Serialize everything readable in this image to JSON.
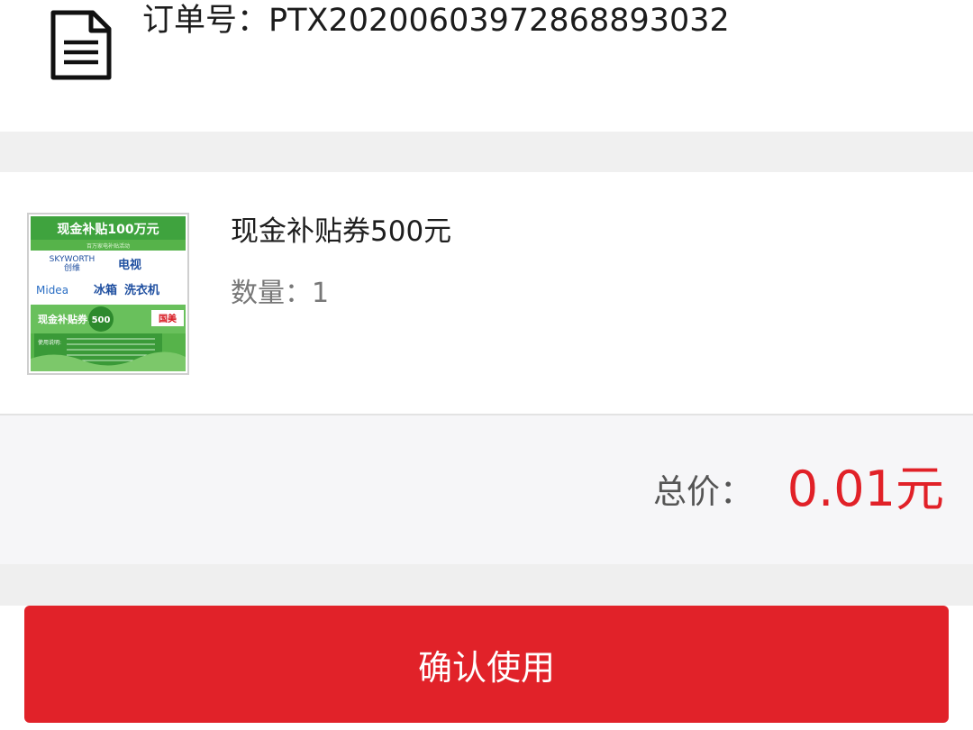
{
  "order": {
    "icon": "document-icon",
    "number_label": "订单号：PTX20200603972868893032"
  },
  "item": {
    "name": "现金补贴券500元",
    "quantity_label": "数量：1",
    "thumbnail": {
      "banner": "现金补贴100万元",
      "subline": "百万家电补贴活动",
      "brand1": "SKYWORTH",
      "brand1_cn": "创维",
      "product1": "电视",
      "brand2": "Midea",
      "product2": "冰箱",
      "product3": "洗衣机",
      "coupon_text": "现金补贴券:",
      "coupon_value": "500",
      "coupon_unit": "元",
      "store_logo": "国美",
      "usage_label": "使用说明:",
      "colors": {
        "green": "#3aa83a",
        "header_green": "#45b04a"
      }
    }
  },
  "total": {
    "label": "总价：",
    "value": "0.01元",
    "value_color": "#e12128"
  },
  "action": {
    "confirm_label": "确认使用",
    "color": "#e12229"
  }
}
